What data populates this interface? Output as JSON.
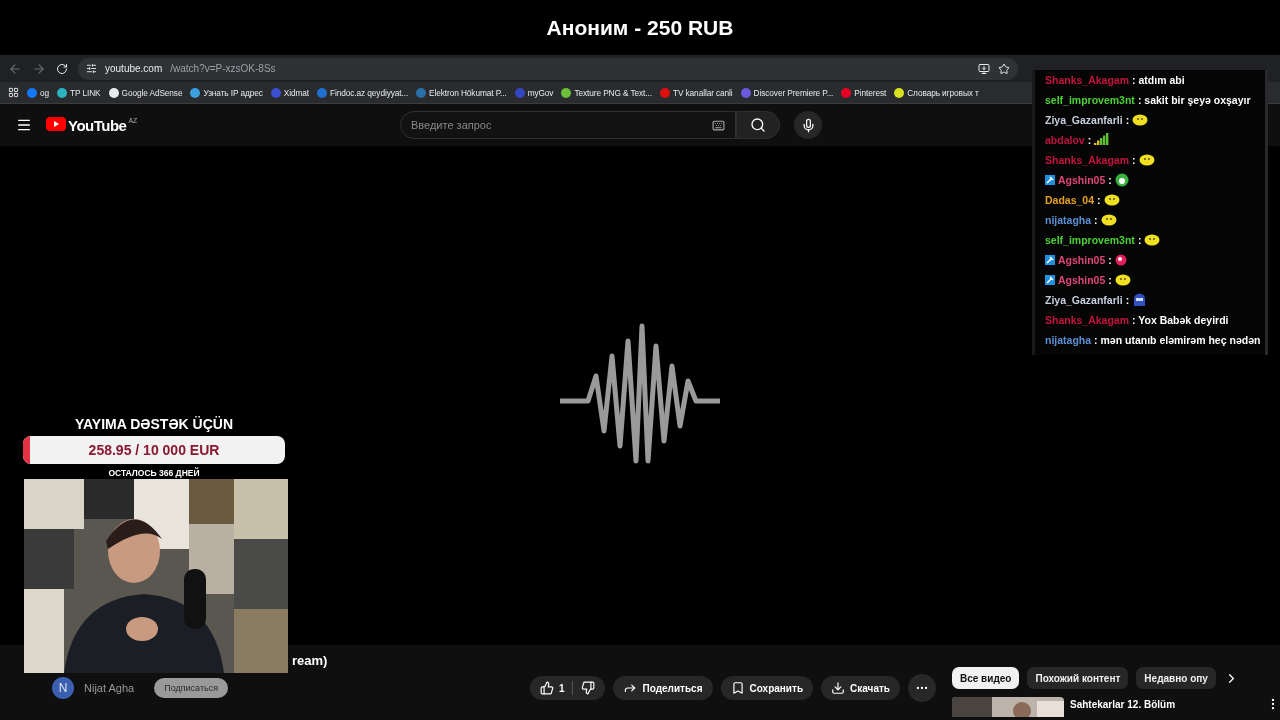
{
  "stream_title": "Аноним - 250 RUB",
  "browser": {
    "url_host": "youtube.com",
    "url_path": "/watch?v=P-xzsOK-8Ss",
    "bookmarks": [
      {
        "label": "og",
        "color": "#1877f2"
      },
      {
        "label": "TP LINK",
        "color": "#2bb3c0"
      },
      {
        "label": "Google AdSense",
        "color": "#e8eaed"
      },
      {
        "label": "Узнать IP адрес",
        "color": "#3aa0e0"
      },
      {
        "label": "Xidmat",
        "color": "#3b4fd0"
      },
      {
        "label": "Findoc.az qeydiyyat...",
        "color": "#1f6fd0"
      },
      {
        "label": "Elektron Hökumat P...",
        "color": "#2a6fa8"
      },
      {
        "label": "myGov",
        "color": "#3346c0"
      },
      {
        "label": "Texture PNG & Text...",
        "color": "#6bbf3a"
      },
      {
        "label": "TV kanallar canli",
        "color": "#e01010"
      },
      {
        "label": "Discover Premiere P...",
        "color": "#6a5ae0"
      },
      {
        "label": "Pinterest",
        "color": "#e60023"
      },
      {
        "label": "Словарь игровых т",
        "color": "#d8e020"
      }
    ]
  },
  "youtube": {
    "logo_text": "YouTube",
    "region": "AZ",
    "search": {
      "placeholder": "Введите запрос"
    }
  },
  "video": {
    "title": "ream)",
    "channel": {
      "initial": "N",
      "name": "Nijat Agha",
      "subscribe": "Подписаться"
    },
    "likes": "1",
    "actions": [
      {
        "kind": "share",
        "label": "Поделиться"
      },
      {
        "kind": "save",
        "label": "Сохранить"
      },
      {
        "kind": "download",
        "label": "Скачать"
      }
    ]
  },
  "filters": [
    {
      "label": "Все видео",
      "selected": true
    },
    {
      "label": "Похожий контент",
      "selected": false
    },
    {
      "label": "Недавно опу",
      "selected": false
    }
  ],
  "recommended": [
    {
      "title": "Sahtekarlar 12. Bölüm"
    }
  ],
  "donation_goal": {
    "title": "YAYIMA DƏSTƏK ÜÇÜN",
    "amount": "258.95 / 10 000 EUR",
    "level": 0.026,
    "remaining": "ОСТАЛОСЬ 366 ДНЕЙ"
  },
  "chat": [
    {
      "user": "Shanks_Akagam",
      "color": "#c8143c",
      "moderator": false,
      "kind": "text",
      "message": ": atdım abi"
    },
    {
      "user": "self_improvem3nt",
      "color": "#4cd137",
      "moderator": false,
      "kind": "text",
      "message": ": sakit bir şeyə oxşayır"
    },
    {
      "user": "Ziya_Gazanfarli",
      "color": "#c8d0e0",
      "moderator": false,
      "kind": "blob",
      "message": ":"
    },
    {
      "user": "abdalov",
      "color": "#c01440",
      "moderator": false,
      "kind": "bars",
      "message": ":"
    },
    {
      "user": "Shanks_Akagam",
      "color": "#c8143c",
      "moderator": false,
      "kind": "blob",
      "message": ":"
    },
    {
      "user": "Agshin05",
      "color": "#e0457b",
      "moderator": true,
      "kind": "frog",
      "message": ":"
    },
    {
      "user": "Dadas_04",
      "color": "#e8a020",
      "moderator": false,
      "kind": "blob",
      "message": ":"
    },
    {
      "user": "nijatagha",
      "color": "#5b8fd6",
      "moderator": false,
      "kind": "blob",
      "message": ":"
    },
    {
      "user": "self_improvem3nt",
      "color": "#4cd137",
      "moderator": false,
      "kind": "blob",
      "message": ":"
    },
    {
      "user": "Agshin05",
      "color": "#e0457b",
      "moderator": true,
      "kind": "orb",
      "message": ":"
    },
    {
      "user": "Agshin05",
      "color": "#e0457b",
      "moderator": true,
      "kind": "blob",
      "message": ":"
    },
    {
      "user": "Ziya_Gazanfarli",
      "color": "#c8d0e0",
      "moderator": false,
      "kind": "robot",
      "message": ":"
    },
    {
      "user": "Shanks_Akagam",
      "color": "#c8143c",
      "moderator": false,
      "kind": "text",
      "message": ": Yox Babək deyirdi"
    },
    {
      "user": "nijatagha",
      "color": "#5b8fd6",
      "moderator": false,
      "kind": "text",
      "message": ": mən utanıb eləmirəm heç nədən"
    }
  ]
}
